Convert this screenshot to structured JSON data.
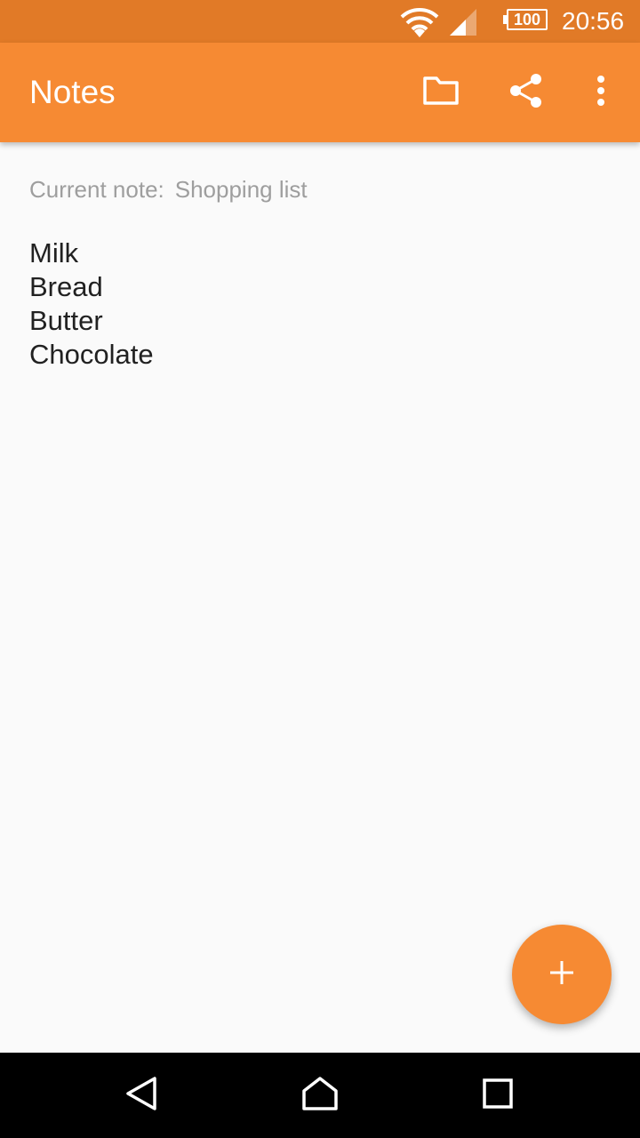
{
  "status_bar": {
    "time": "20:56",
    "battery_level": "100",
    "icons": [
      "wifi-icon",
      "signal-icon",
      "battery-icon"
    ]
  },
  "app_bar": {
    "title": "Notes",
    "actions": [
      "folder-icon",
      "share-icon",
      "more-vert-icon"
    ]
  },
  "current_note": {
    "label": "Current note:",
    "name": "Shopping list"
  },
  "note_body": {
    "lines": [
      "Milk",
      "Bread",
      "Butter",
      "Chocolate"
    ]
  },
  "fab": {
    "icon": "add-icon"
  },
  "nav_bar": {
    "icons": [
      "back-icon",
      "home-icon",
      "recents-icon"
    ]
  },
  "colors": {
    "status_bar": "#E17A27",
    "app_bar": "#F68A33",
    "accent": "#F68A33",
    "background": "#FAFAFA",
    "secondary_text": "#9E9E9E",
    "primary_text": "#212121"
  }
}
